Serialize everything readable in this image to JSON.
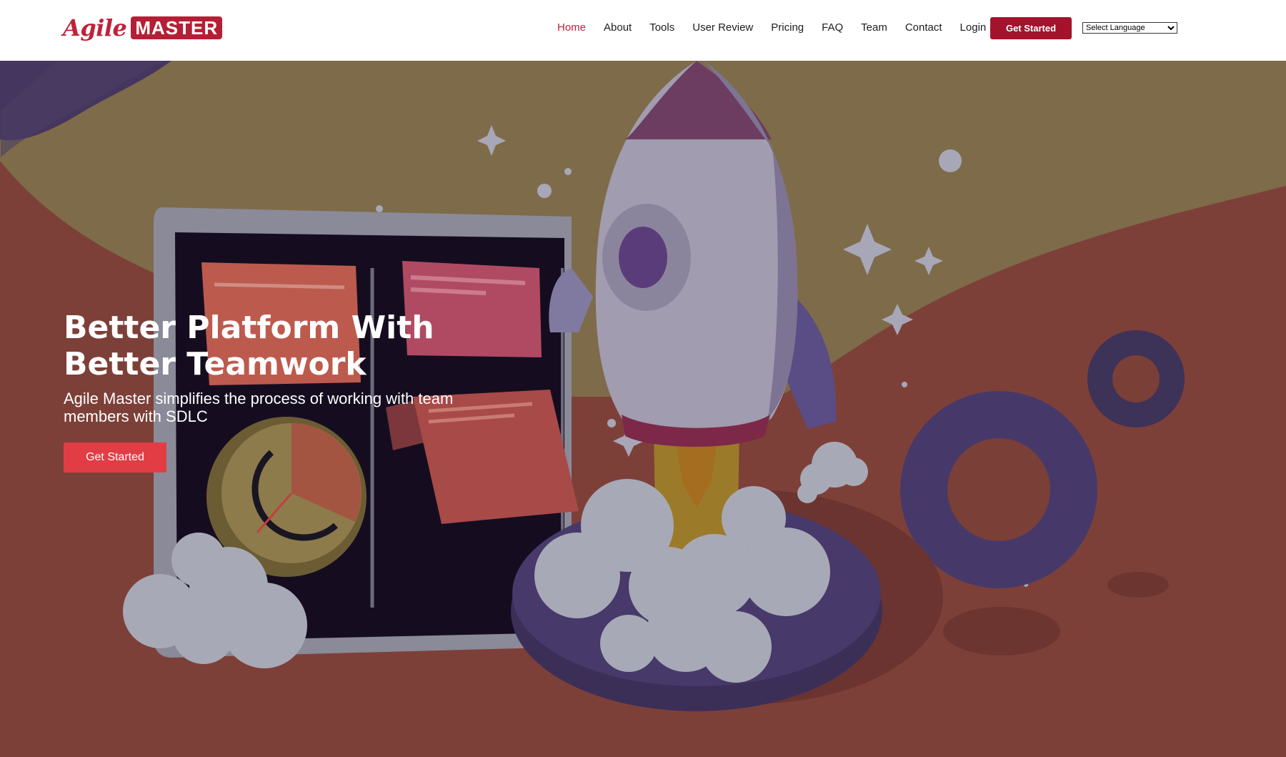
{
  "header": {
    "logo_script": "Agile",
    "logo_box": "MASTER",
    "nav": [
      {
        "label": "Home",
        "active": true
      },
      {
        "label": "About",
        "active": false
      },
      {
        "label": "Tools",
        "active": false
      },
      {
        "label": "User Review",
        "active": false
      },
      {
        "label": "Pricing",
        "active": false
      },
      {
        "label": "FAQ",
        "active": false
      },
      {
        "label": "Team",
        "active": false
      },
      {
        "label": "Contact",
        "active": false
      },
      {
        "label": "Login",
        "active": false
      }
    ],
    "cta_label": "Get Started",
    "language_select": {
      "selected": "Select Language"
    }
  },
  "hero": {
    "title": "Better Platform With Better Teamwork",
    "subtitle": "Agile Master simplifies the process of working with team members with SDLC",
    "cta_label": "Get Started"
  },
  "colors": {
    "brand": "#a4122c",
    "nav_active": "#c0223a",
    "hero_button": "#e23d45",
    "hero_background": "#793f37"
  }
}
